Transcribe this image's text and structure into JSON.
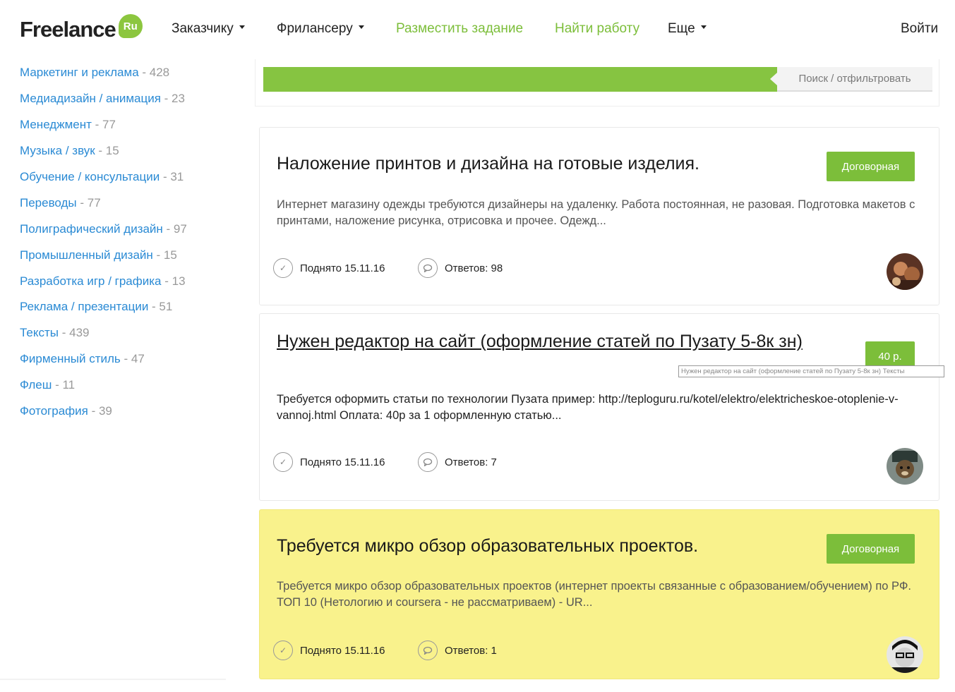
{
  "header": {
    "logo_text": "Freelance",
    "logo_badge": "Ru",
    "nav": {
      "customer": "Заказчику",
      "freelancer": "Фрилансеру",
      "post_task": "Разместить задание",
      "find_work": "Найти работу",
      "more": "Еще",
      "login": "Войти"
    }
  },
  "sidebar": {
    "categories": [
      {
        "name": "Маркетинг и реклама",
        "count": " - 428"
      },
      {
        "name": "Медиадизайн / анимация",
        "count": " - 23"
      },
      {
        "name": "Менеджмент",
        "count": " - 77"
      },
      {
        "name": "Музыка / звук",
        "count": " - 15"
      },
      {
        "name": "Обучение / консультации",
        "count": " - 31"
      },
      {
        "name": "Переводы",
        "count": " - 77"
      },
      {
        "name": "Полиграфический дизайн",
        "count": " - 97"
      },
      {
        "name": "Промышленный дизайн",
        "count": " - 15"
      },
      {
        "name": "Разработка игр / графика",
        "count": " - 13"
      },
      {
        "name": "Реклама / презентации",
        "count": " - 51"
      },
      {
        "name": "Тексты",
        "count": " - 439"
      },
      {
        "name": "Фирменный стиль",
        "count": " - 47"
      },
      {
        "name": "Флеш",
        "count": " - 11"
      },
      {
        "name": "Фотография",
        "count": " - 39"
      }
    ]
  },
  "filter": {
    "button_label": "Поиск / отфильтровать"
  },
  "cards": [
    {
      "title": "Наложение принтов и дизайна на готовые изделия.",
      "price": "Договорная",
      "description": "Интернет магазину одежды требуются дизайнеры на удаленку. Работа постоянная, не разовая. Подготовка макетов с принтами, наложение рисунка, отрисовка и прочее. Одежд...",
      "raised": "Поднято 15.11.16",
      "replies": "Ответов: 98"
    },
    {
      "title": "Нужен редактор на сайт (оформление статей по Пузату 5-8к зн)",
      "price": "40 р.",
      "description": "Требуется оформить статьи по технологии Пузата пример: http://teploguru.ru/kotel/elektro/elektricheskoe-otoplenie-v-vannoj.html Оплата: 40р за 1 оформленную статью...",
      "raised": "Поднято 15.11.16",
      "replies": "Ответов: 7",
      "tooltip": "Нужен редактор на сайт (оформление статей по Пузату 5-8к зн) Тексты"
    },
    {
      "title": "Требуется микро обзор образовательных проектов.",
      "price": "Договорная",
      "description": "Требуется микро обзор образовательных проектов (интернет проекты связанные с образованием/обучением) по РФ. ТОП 10 (Нетологию и coursera - не рассматриваем) - UR...",
      "raised": "Поднято 15.11.16",
      "replies": "Ответов: 1"
    }
  ],
  "colors": {
    "brand_green": "#7cbe3a",
    "link_blue": "#2a8ad4",
    "highlight_yellow": "#f9f28c"
  }
}
